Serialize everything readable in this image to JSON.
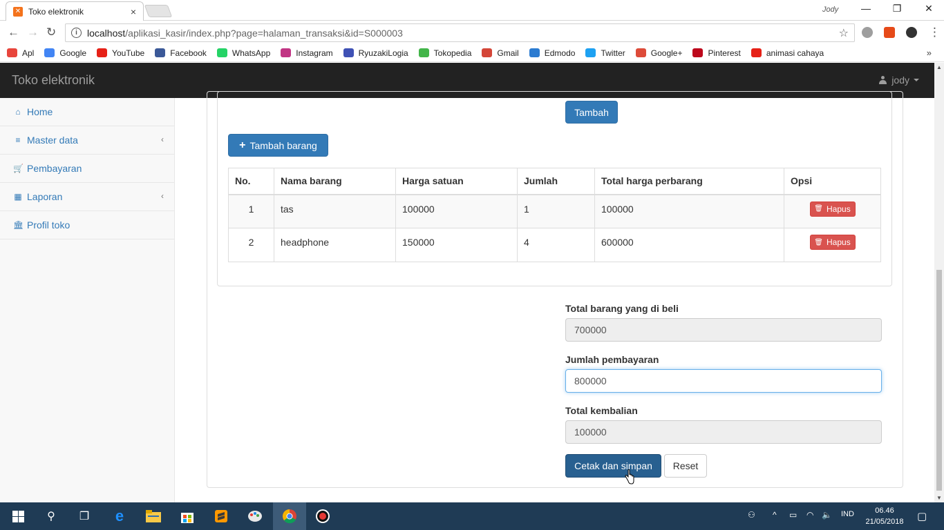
{
  "browser": {
    "tab_title": "Toko elektronik",
    "tab_close": "×",
    "profile": "Jody",
    "window_controls": [
      "—",
      "❐",
      "✕"
    ],
    "url_host": "localhost",
    "url_path": "/aplikasi_kasir/index.php?page=halaman_transaksi&id=S000003",
    "bookmarks": [
      {
        "label": "Apl",
        "icon": "apps-grid-icon",
        "color": "#e8453c"
      },
      {
        "label": "Google",
        "icon": "google-icon",
        "color": "#4285f4"
      },
      {
        "label": "YouTube",
        "icon": "youtube-icon",
        "color": "#e62117"
      },
      {
        "label": "Facebook",
        "icon": "facebook-icon",
        "color": "#3b5998"
      },
      {
        "label": "WhatsApp",
        "icon": "whatsapp-icon",
        "color": "#25d366"
      },
      {
        "label": "Instagram",
        "icon": "instagram-icon",
        "color": "#c13584"
      },
      {
        "label": "RyuzakiLogia",
        "icon": "ryuzakilogia-icon",
        "color": "#3f51b5"
      },
      {
        "label": "Tokopedia",
        "icon": "tokopedia-icon",
        "color": "#42b549"
      },
      {
        "label": "Gmail",
        "icon": "gmail-icon",
        "color": "#d44638"
      },
      {
        "label": "Edmodo",
        "icon": "edmodo-icon",
        "color": "#2b7bd1"
      },
      {
        "label": "Twitter",
        "icon": "twitter-icon",
        "color": "#1da1f2"
      },
      {
        "label": "Google+",
        "icon": "google-plus-icon",
        "color": "#dd4b39"
      },
      {
        "label": "Pinterest",
        "icon": "pinterest-icon",
        "color": "#bd081c"
      },
      {
        "label": "animasi cahaya",
        "icon": "youtube-icon",
        "color": "#e62117"
      }
    ],
    "bookmarks_more": "»"
  },
  "app": {
    "brand": "Toko elektronik",
    "user": "jody",
    "sidebar": [
      {
        "label": "Home",
        "icon": "home-icon",
        "glyph": "⌂",
        "has_children": false
      },
      {
        "label": "Master data",
        "icon": "database-icon",
        "glyph": "≡",
        "has_children": true
      },
      {
        "label": "Pembayaran",
        "icon": "cart-icon",
        "glyph": "🛒",
        "has_children": false
      },
      {
        "label": "Laporan",
        "icon": "table-icon",
        "glyph": "▦",
        "has_children": true
      },
      {
        "label": "Profil toko",
        "icon": "bank-icon",
        "glyph": "🏛",
        "has_children": false
      }
    ],
    "chevron": "‹"
  },
  "transaction": {
    "tambah_button": "Tambah",
    "tambah_barang_button": "Tambah barang",
    "columns": [
      "No.",
      "Nama barang",
      "Harga satuan",
      "Jumlah",
      "Total harga perbarang",
      "Opsi"
    ],
    "rows": [
      {
        "no": "1",
        "nama": "tas",
        "harga": "100000",
        "jumlah": "1",
        "total": "100000",
        "action": "Hapus"
      },
      {
        "no": "2",
        "nama": "headphone",
        "harga": "150000",
        "jumlah": "4",
        "total": "600000",
        "action": "Hapus"
      }
    ],
    "total_label": "Total barang yang di beli",
    "total_value": "700000",
    "bayar_label": "Jumlah pembayaran",
    "bayar_value": "800000",
    "kembalian_label": "Total kembalian",
    "kembalian_value": "100000",
    "save_button": "Cetak dan simpan",
    "reset_button": "Reset"
  },
  "taskbar": {
    "language": "IND",
    "time": "06.46",
    "date": "21/05/2018"
  },
  "colors": {
    "primary": "#337ab7",
    "danger": "#d9534f",
    "navbar": "#222222",
    "taskbar": "#1f3b55"
  }
}
